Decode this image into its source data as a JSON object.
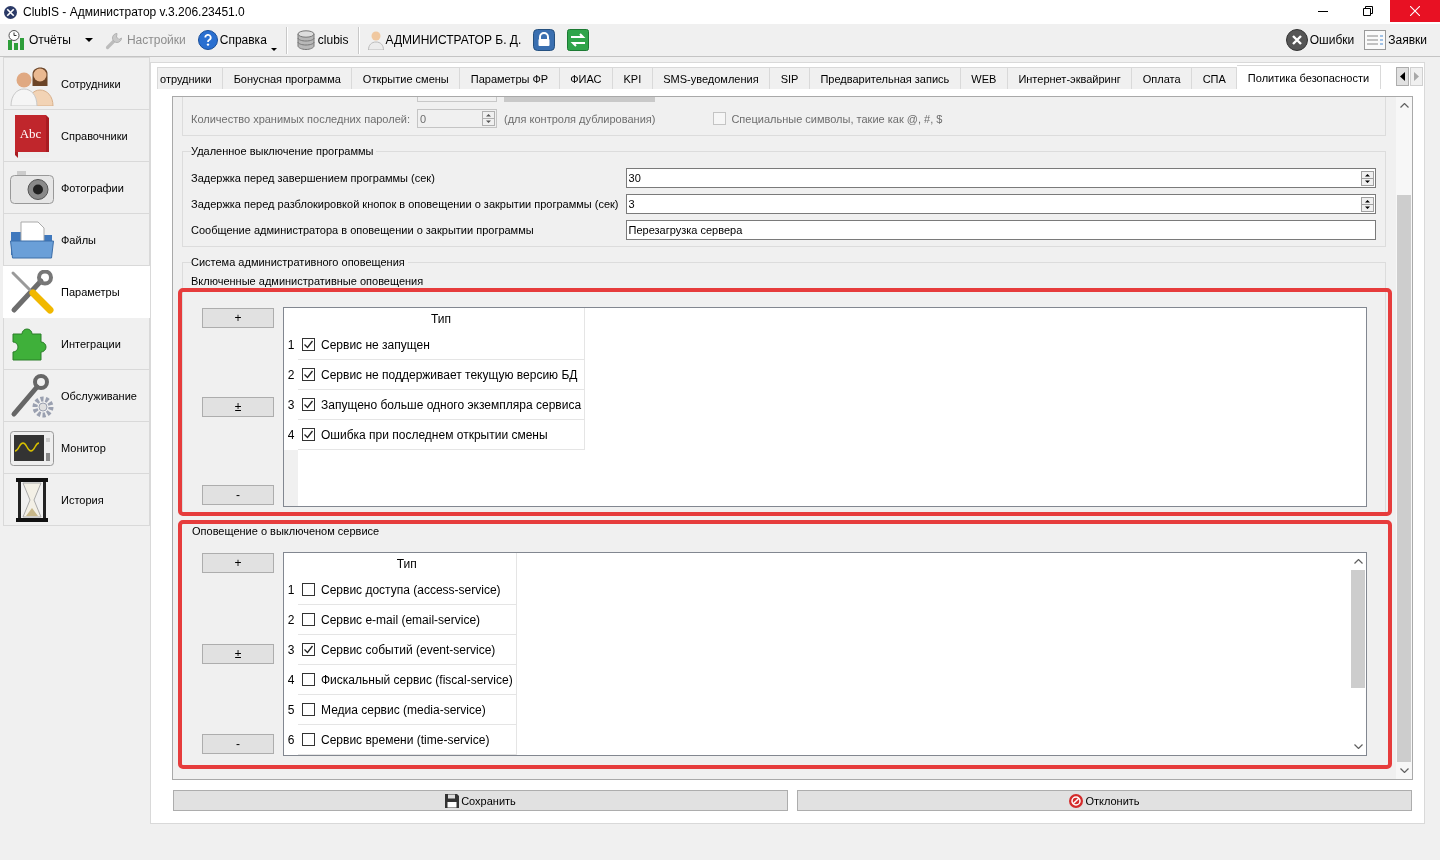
{
  "window": {
    "title": "ClubIS - Администратор v.3.206.23451.0"
  },
  "toolbar": {
    "groups": [
      [
        {
          "kind": "split",
          "label": "Отчёты",
          "disabled": false
        },
        {
          "kind": "button",
          "label": "Настройки",
          "disabled": true
        },
        {
          "kind": "menu",
          "label": "Справка",
          "disabled": false
        }
      ],
      [
        {
          "kind": "button",
          "label": "clubis",
          "disabled": false
        }
      ],
      [
        {
          "kind": "button",
          "label": "АДМИНИСТРАТОР Б. Д.",
          "disabled": false
        },
        {
          "kind": "icon",
          "disabled": false
        },
        {
          "kind": "icon",
          "disabled": false
        }
      ]
    ],
    "right": [
      {
        "label": "Ошибки",
        "disabled": false
      },
      {
        "label": "Заявки",
        "disabled": false
      }
    ]
  },
  "sidebar": {
    "items": [
      {
        "label": "Сотрудники",
        "selected": false
      },
      {
        "label": "Справочники",
        "selected": false,
        "icon_text": "Abc"
      },
      {
        "label": "Фотографии",
        "selected": false
      },
      {
        "label": "Файлы",
        "selected": false
      },
      {
        "label": "Параметры",
        "selected": true
      },
      {
        "label": "Интеграции",
        "selected": false
      },
      {
        "label": "Обслуживание",
        "selected": false
      },
      {
        "label": "Монитор",
        "selected": false
      },
      {
        "label": "История",
        "selected": false
      }
    ]
  },
  "tabs": [
    {
      "label": "отрудники",
      "selected": false
    },
    {
      "label": "Бонусная программа",
      "selected": false
    },
    {
      "label": "Открытие смены",
      "selected": false
    },
    {
      "label": "Параметры ФР",
      "selected": false
    },
    {
      "label": "ФИАС",
      "selected": false
    },
    {
      "label": "KPI",
      "selected": false
    },
    {
      "label": "SMS-уведомления",
      "selected": false
    },
    {
      "label": "SIP",
      "selected": false
    },
    {
      "label": "Предварительная запись",
      "selected": false
    },
    {
      "label": "WEB",
      "selected": false
    },
    {
      "label": "Интернет-эквайринг",
      "selected": false
    },
    {
      "label": "Оплата",
      "selected": false
    },
    {
      "label": "СПА",
      "selected": false
    },
    {
      "label": "Политика безопасности",
      "selected": true
    }
  ],
  "tab_scroll": [
    {
      "disabled": false
    },
    {
      "disabled": true
    }
  ],
  "password_policy": {
    "history": {
      "label": "Количество хранимых последних паролей:",
      "value": "0",
      "hint": "(для контроля дублирования)",
      "disabled": true
    },
    "special_chars": {
      "label": "Специальные символы, такие как @, #, $",
      "checked": false,
      "disabled": true
    }
  },
  "remote_shutdown": {
    "title": "Удаленное выключение программы",
    "rows": [
      {
        "kind": "spin",
        "label": "Задержка перед завершением программы (сек)",
        "value": "30"
      },
      {
        "kind": "spin",
        "label": "Задержка перед разблокировкой кнопок в оповещении о закрытии программы (сек)",
        "value": "3"
      },
      {
        "kind": "text",
        "label": "Сообщение администратора в оповещении о закрытии программы",
        "value": "Перезагрузка сервера"
      }
    ]
  },
  "admin_notifications": {
    "title": "Система административного оповещения",
    "subtitle": "Включенные административные оповещения",
    "highlighted": true,
    "buttons": [
      "+",
      "±",
      "-"
    ],
    "table": {
      "column": "Тип",
      "scrollable": false,
      "rows": [
        {
          "number": "1",
          "label": "Сервис не запущен",
          "checked": true
        },
        {
          "number": "2",
          "label": "Сервис не поддерживает текущую версию БД",
          "checked": true
        },
        {
          "number": "3",
          "label": "Запущено больше одного экземпляра сервиса",
          "checked": true
        },
        {
          "number": "4",
          "label": "Ошибка при последнем открытии смены",
          "checked": true
        }
      ]
    }
  },
  "service_off_notification": {
    "title": "Оповещение о выключеном сервисе",
    "highlighted": true,
    "buttons": [
      "+",
      "±",
      "-"
    ],
    "table": {
      "column": "Тип",
      "scrollable": true,
      "rows": [
        {
          "number": "1",
          "label": "Сервис доступа (access-service)",
          "checked": false
        },
        {
          "number": "2",
          "label": "Сервис e-mail (email-service)",
          "checked": false
        },
        {
          "number": "3",
          "label": "Сервис событий (event-service)",
          "checked": true
        },
        {
          "number": "4",
          "label": "Фискальный сервис (fiscal-service)",
          "checked": false
        },
        {
          "number": "5",
          "label": "Медиа сервис (media-service)",
          "checked": false
        },
        {
          "number": "6",
          "label": "Сервис времени (time-service)",
          "checked": false
        }
      ]
    }
  },
  "footer": {
    "buttons": [
      {
        "label": "Сохранить"
      },
      {
        "label": "Отклонить"
      }
    ]
  }
}
